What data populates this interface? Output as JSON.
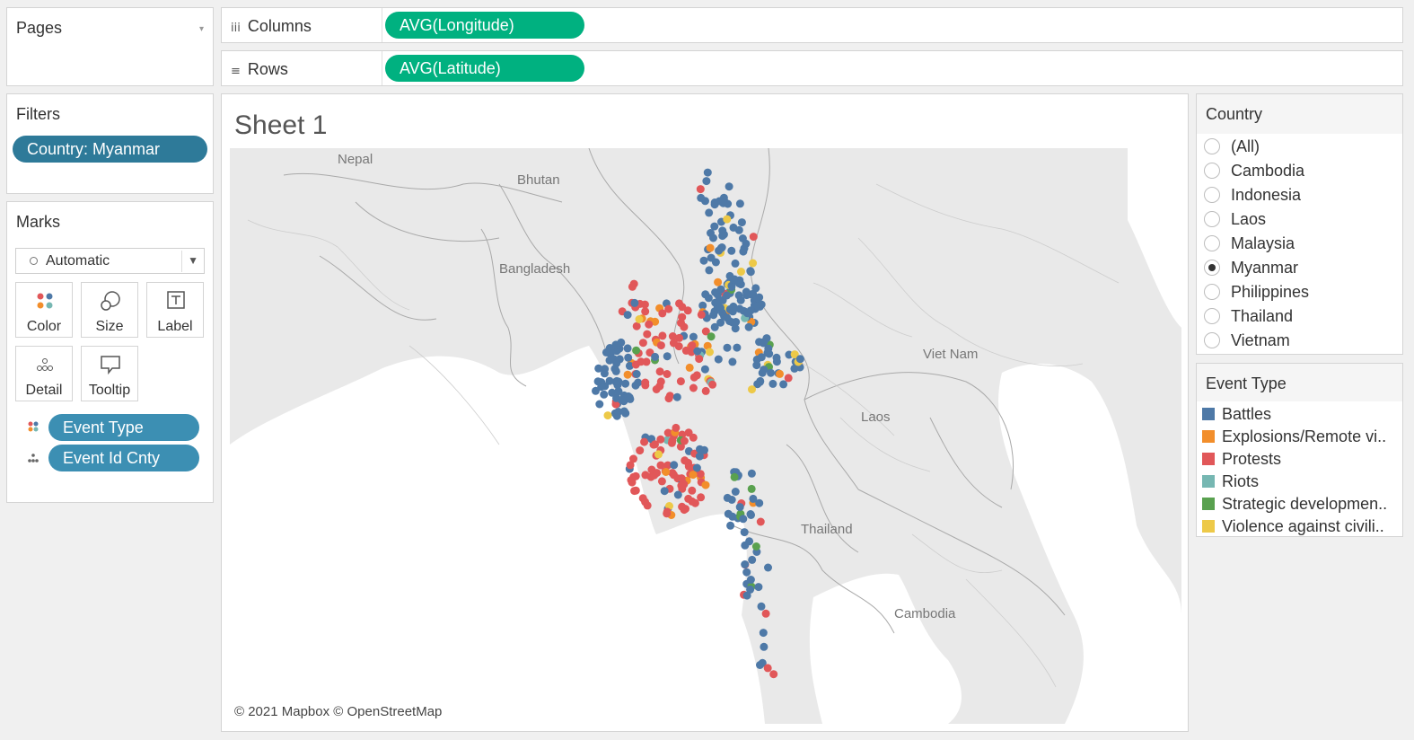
{
  "pages": {
    "title": "Pages"
  },
  "shelves": {
    "columns_label": "Columns",
    "columns_pill": "AVG(Longitude)",
    "rows_label": "Rows",
    "rows_pill": "AVG(Latitude)"
  },
  "filters": {
    "title": "Filters",
    "pill": "Country: Myanmar"
  },
  "marks": {
    "title": "Marks",
    "type_value": "Automatic",
    "buttons": {
      "color": "Color",
      "size": "Size",
      "label": "Label",
      "detail": "Detail",
      "tooltip": "Tooltip"
    },
    "pills": {
      "event_type": "Event Type",
      "event_id": "Event Id Cnty"
    }
  },
  "sheet": {
    "title": "Sheet 1",
    "attribution": "© 2021 Mapbox © OpenStreetMap",
    "map_labels": {
      "nepal": "Nepal",
      "bhutan": "Bhutan",
      "bangladesh": "Bangladesh",
      "vietnam": "Viet Nam",
      "laos": "Laos",
      "thailand": "Thailand",
      "cambodia": "Cambodia"
    }
  },
  "country_filter": {
    "title": "Country",
    "options": [
      "(All)",
      "Cambodia",
      "Indonesia",
      "Laos",
      "Malaysia",
      "Myanmar",
      "Philippines",
      "Thailand",
      "Vietnam"
    ],
    "selected": "Myanmar"
  },
  "event_legend": {
    "title": "Event Type",
    "items": [
      {
        "label": "Battles",
        "color": "#4e79a7"
      },
      {
        "label": "Explosions/Remote vi..",
        "color": "#f28e2b"
      },
      {
        "label": "Protests",
        "color": "#e15759"
      },
      {
        "label": "Riots",
        "color": "#76b7b2"
      },
      {
        "label": "Strategic developmen..",
        "color": "#59a14f"
      },
      {
        "label": "Violence against civili..",
        "color": "#edc948"
      }
    ]
  },
  "colors": {
    "accent_green": "#00b180",
    "pill_teal": "#3c8fb3"
  },
  "icons": {
    "dropdown": "chevron-down-icon",
    "color": "color-dots-icon",
    "size": "size-circles-icon",
    "label": "label-t-icon",
    "detail": "detail-dots-icon",
    "tooltip": "tooltip-bubble-icon"
  }
}
